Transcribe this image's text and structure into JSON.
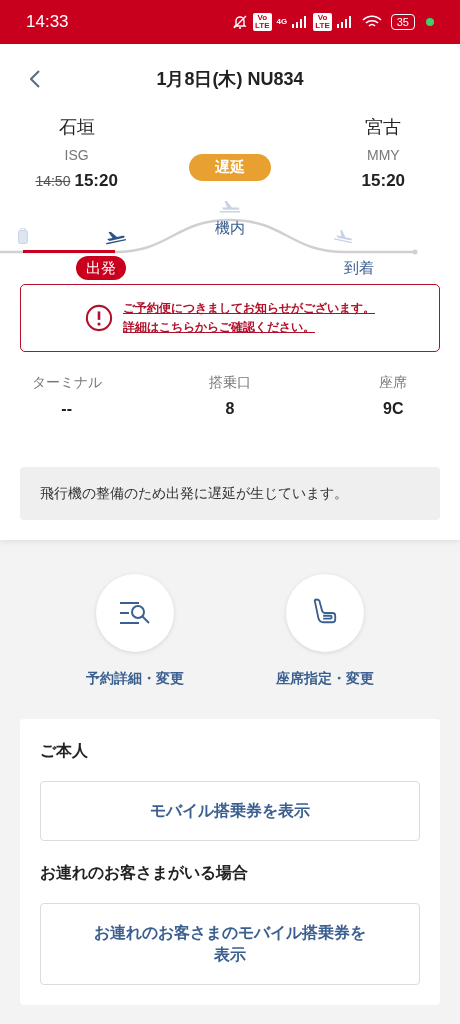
{
  "status_bar": {
    "time": "14:33",
    "network": "4G",
    "volte": [
      {
        "top": "Vo",
        "bottom": "LTE"
      },
      {
        "top": "Vo",
        "bottom": "LTE"
      }
    ],
    "battery": "35"
  },
  "header": {
    "title": "1月8日(木) NU834"
  },
  "departure": {
    "city": "石垣",
    "code": "ISG",
    "scheduled": "14:50",
    "time": "15:20"
  },
  "arrival": {
    "city": "宮古",
    "code": "MMY",
    "time": "15:20"
  },
  "status_badge": "遅延",
  "timeline": {
    "stages": [
      {
        "label": "出発",
        "selected": true
      },
      {
        "label": "機内",
        "selected": false
      },
      {
        "label": "到着",
        "selected": false
      }
    ]
  },
  "notice": [
    "ご予約便につきましてお知らせがございます。",
    "詳細はこちらからご確認ください。"
  ],
  "info": [
    {
      "label": "ターミナル",
      "value": "--"
    },
    {
      "label": "搭乗口",
      "value": "8"
    },
    {
      "label": "座席",
      "value": "9C"
    }
  ],
  "message": "飛行機の整備のため出発に遅延が生じています。",
  "actions": [
    {
      "kind": "reservation",
      "label": "予約詳細・変更"
    },
    {
      "kind": "seat",
      "label": "座席指定・変更"
    }
  ],
  "boarding": [
    {
      "heading": "ご本人",
      "button": "モバイル搭乗券を表示"
    },
    {
      "heading": "お連れのお客さまがいる場合",
      "button": "お連れのお客さまのモバイル搭乗券を表示"
    }
  ]
}
